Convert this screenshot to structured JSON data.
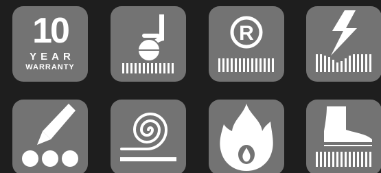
{
  "icons": [
    {
      "name": "warranty-badge",
      "number": "10",
      "line1": "YEAR",
      "line2": "WARRANTY"
    },
    {
      "name": "castor-chair-icon"
    },
    {
      "name": "registered-trademark-icon"
    },
    {
      "name": "antistatic-icon"
    },
    {
      "name": "dye-pen-icon"
    },
    {
      "name": "roll-spiral-icon"
    },
    {
      "name": "fire-flame-icon"
    },
    {
      "name": "boot-icon"
    }
  ],
  "colors": {
    "background": "#1e1e1e",
    "tile": "#737373",
    "glyph": "#ffffff"
  }
}
